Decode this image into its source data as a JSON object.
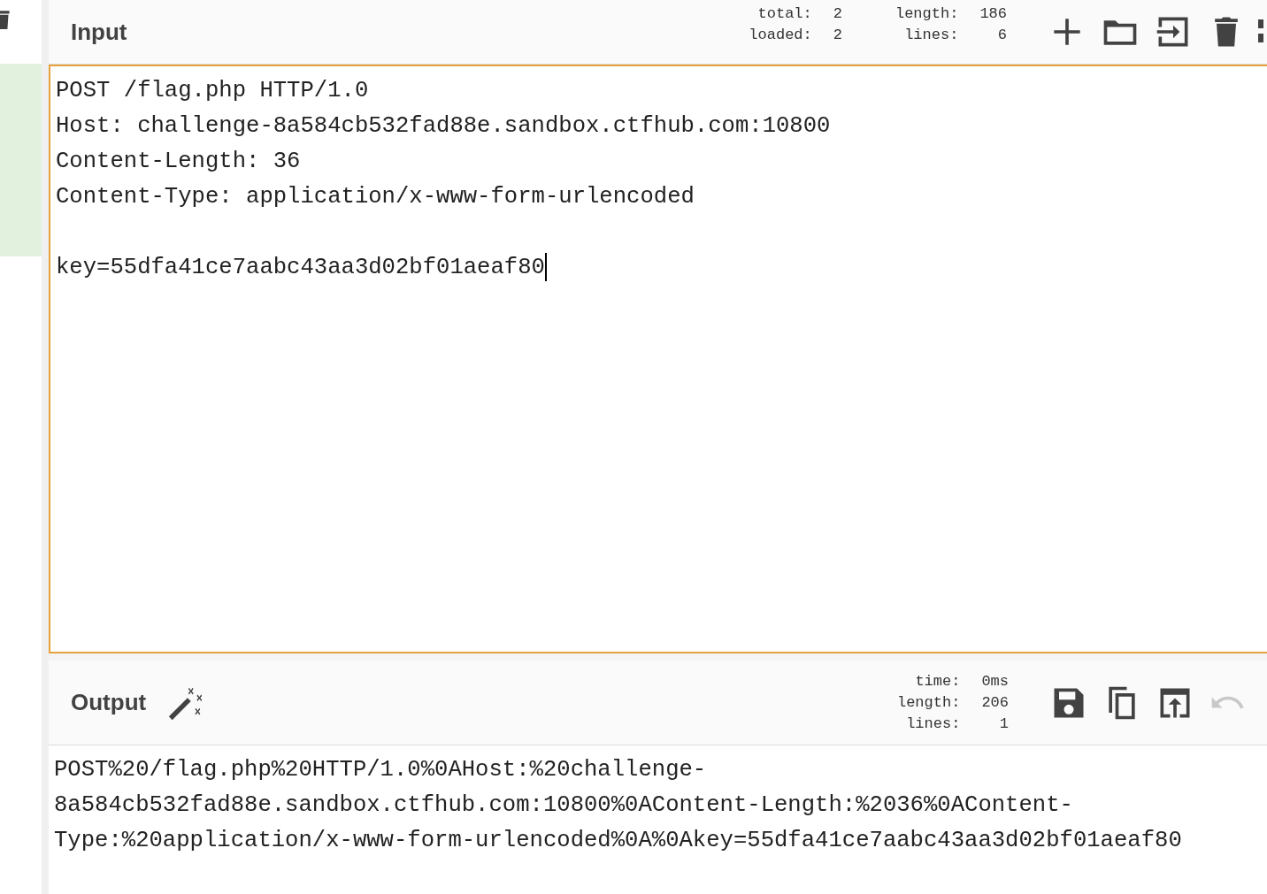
{
  "input": {
    "title": "Input",
    "stats": [
      {
        "label": "total:",
        "value": "2"
      },
      {
        "label": "loaded:",
        "value": "2"
      }
    ],
    "stats2": [
      {
        "label": "length:",
        "value": "186"
      },
      {
        "label": "lines:",
        "value": "6"
      }
    ],
    "text": "POST /flag.php HTTP/1.0\nHost: challenge-8a584cb532fad88e.sandbox.ctfhub.com:10800\nContent-Length: 36\nContent-Type: application/x-www-form-urlencoded\n\nkey=55dfa41ce7aabc43aa3d02bf01aeaf80"
  },
  "output": {
    "title": "Output",
    "stats": [
      {
        "label": "time:",
        "value": "0ms"
      },
      {
        "label": "length:",
        "value": "206"
      },
      {
        "label": "lines:",
        "value": "1"
      }
    ],
    "undo": {
      "disabled": true
    },
    "text": "POST%20/flag.php%20HTTP/1.0%0AHost:%20challenge-8a584cb532fad88e.sandbox.ctfhub.com:10800%0AContent-Length:%2036%0AContent-Type:%20application/x-www-form-urlencoded%0A%0Akey=55dfa41ce7aabc43aa3d02bf01aeaf80"
  }
}
